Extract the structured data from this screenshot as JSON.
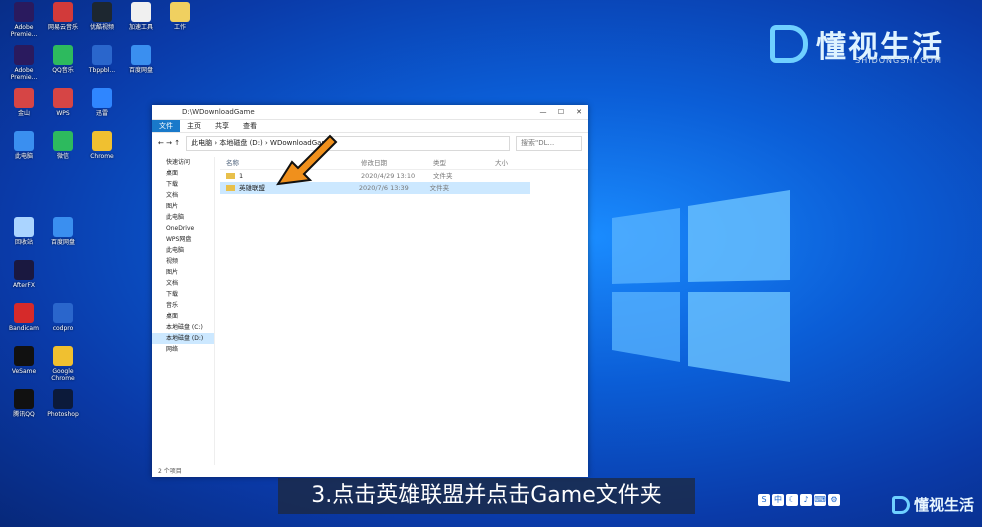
{
  "brand": {
    "name": "懂视生活",
    "domain": "SHIDONGSHI.COM",
    "accent": "#6fd0ff"
  },
  "desktop_icons": [
    {
      "label": "Adobe Premie...",
      "color": "#2a1a5e"
    },
    {
      "label": "网易云音乐",
      "color": "#d23a3a"
    },
    {
      "label": "优酷视频",
      "color": "#1d2730"
    },
    {
      "label": "加速工具",
      "color": "#f0f0f0"
    },
    {
      "label": "工作",
      "color": "#f0d060"
    },
    {
      "label": "Adobe Premie...",
      "color": "#2a1a5e"
    },
    {
      "label": "QQ音乐",
      "color": "#2dba5e"
    },
    {
      "label": "Tbppbl...",
      "color": "#2a66cc"
    },
    {
      "label": "百度网盘",
      "color": "#3a8ff0"
    },
    {
      "label": "金山",
      "color": "#d64545"
    },
    {
      "label": "WPS",
      "color": "#d64545"
    },
    {
      "label": "迅雷",
      "color": "#2f86ff"
    },
    {
      "label": "此电脑",
      "color": "#3a8ff0"
    },
    {
      "label": "微信",
      "color": "#2dba5e"
    },
    {
      "label": "Chrome",
      "color": "#f0c030"
    },
    {
      "label": "回收站",
      "color": "#aad4ff"
    },
    {
      "label": "百度网盘",
      "color": "#3a8ff0"
    },
    {
      "label": "AfterFX",
      "color": "#1a1840"
    },
    {
      "label": "Bandicam",
      "color": "#d62a2a"
    },
    {
      "label": "codpro",
      "color": "#2a66cc"
    },
    {
      "label": "VeSame",
      "color": "#111111"
    },
    {
      "label": "Google Chrome",
      "color": "#f0c030"
    },
    {
      "label": "腾讯QQ",
      "color": "#111111"
    },
    {
      "label": "Photoshop",
      "color": "#0c1a3a"
    }
  ],
  "explorer": {
    "title": "D:\\WDownloadGame",
    "ribbon_tabs": [
      "文件",
      "主页",
      "共享",
      "查看"
    ],
    "window_controls": [
      "—",
      "☐",
      "✕"
    ],
    "address": {
      "path": [
        "此电脑",
        "本地磁盘 (D:)",
        "WDownloadGame"
      ]
    },
    "search_placeholder": "搜索\"DL...",
    "nav_items": [
      "快速访问",
      "桌面",
      "下载",
      "文档",
      "图片",
      "此电脑",
      "OneDrive",
      "WPS网盘",
      "此电脑",
      "视频",
      "图片",
      "文档",
      "下载",
      "音乐",
      "桌面",
      "本地磁盘 (C:)",
      "本地磁盘 (D:)",
      "网络"
    ],
    "columns": [
      "名称",
      "修改日期",
      "类型",
      "大小"
    ],
    "rows": [
      {
        "name": "1",
        "date": "2020/4/29 13:10",
        "type": "文件夹",
        "size": ""
      },
      {
        "name": "英雄联盟",
        "date": "2020/7/6 13:39",
        "type": "文件夹",
        "size": ""
      }
    ],
    "status": "2 个项目"
  },
  "caption": "3.点击英雄联盟并点击Game文件夹",
  "tray_items": [
    "S",
    "中",
    "☾",
    "♪",
    "⌨",
    "⚙"
  ]
}
